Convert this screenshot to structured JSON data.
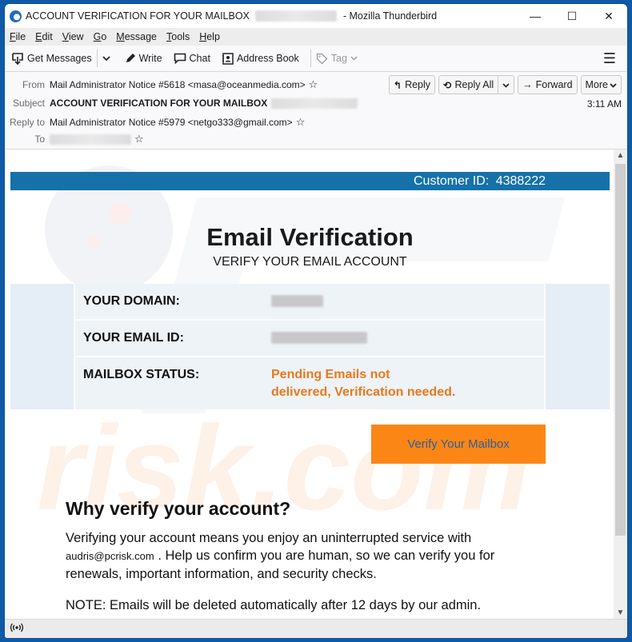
{
  "window": {
    "title_prefix": "ACCOUNT VERIFICATION FOR YOUR MAILBOX",
    "title_suffix": "- Mozilla Thunderbird",
    "controls": {
      "minimize": "—",
      "maximize": "☐",
      "close": "✕"
    }
  },
  "menubar": {
    "items": [
      {
        "label": "File",
        "accel": "F"
      },
      {
        "label": "Edit",
        "accel": "E"
      },
      {
        "label": "View",
        "accel": "V"
      },
      {
        "label": "Go",
        "accel": "G"
      },
      {
        "label": "Message",
        "accel": "M"
      },
      {
        "label": "Tools",
        "accel": "T"
      },
      {
        "label": "Help",
        "accel": "H"
      }
    ]
  },
  "toolbar": {
    "get_messages": "Get Messages",
    "write": "Write",
    "chat": "Chat",
    "address_book": "Address Book",
    "tag": "Tag",
    "icons": {
      "get_messages": "download-icon",
      "write": "pencil-icon",
      "chat": "chat-bubble-icon",
      "address_book": "contact-card-icon",
      "tag": "tag-icon",
      "menu": "hamburger-menu-icon"
    }
  },
  "headers": {
    "from_label": "From",
    "from_value": "Mail Administrator Notice #5618 <masa@oceanmedia.com>",
    "subject_label": "Subject",
    "subject_value": "ACCOUNT VERIFICATION FOR YOUR MAILBOX",
    "replyto_label": "Reply to",
    "replyto_value": "Mail Administrator Notice #5979 <netgo333@gmail.com>",
    "to_label": "To",
    "time": "3:11 AM",
    "buttons": {
      "reply": "Reply",
      "reply_all": "Reply All",
      "forward": "Forward",
      "more": "More"
    }
  },
  "email": {
    "customer_id_label": "Customer ID:",
    "customer_id": "4388222",
    "title": "Email Verification",
    "subtitle": "VERIFY YOUR EMAIL ACCOUNT",
    "rows": [
      {
        "label": "YOUR DOMAIN:",
        "value": ""
      },
      {
        "label": "YOUR EMAIL ID:",
        "value": ""
      },
      {
        "label": "MAILBOX STATUS:",
        "value_line1": "Pending Emails not",
        "value_line2": "delivered, Verification needed."
      }
    ],
    "verify_button": "Verify Your Mailbox",
    "why_title": "Why verify your account?",
    "why_line1": "Verifying your account means you enjoy an uninterrupted service with",
    "why_email": "audris@pcrisk.com",
    "why_line2": " . Help us confirm you are human, so we can verify you for",
    "why_line3": "renewals, important information, and security checks.",
    "note": "NOTE: Emails will be deleted automatically after 12 days by our admin.",
    "colors": {
      "id_bar": "#1571a8",
      "status_text": "#e8791c",
      "verify_button_bg": "#fb8616",
      "verify_button_text": "#2c5f9e"
    }
  },
  "statusbar": {
    "icon": "wireless-signal-icon"
  }
}
